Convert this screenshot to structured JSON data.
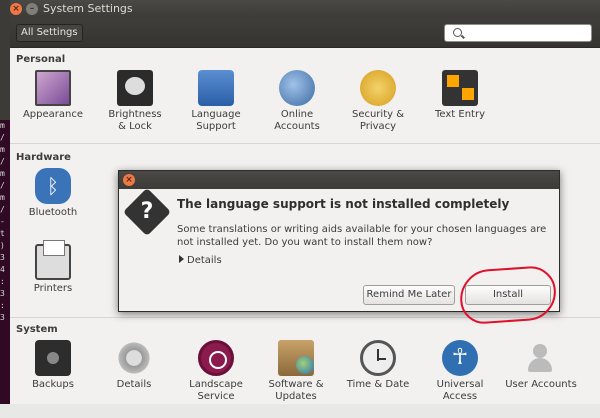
{
  "window": {
    "title": "System Settings"
  },
  "toolbar": {
    "all_settings_label": "All Settings",
    "search_placeholder": ""
  },
  "sections": {
    "personal": {
      "label": "Personal",
      "items": [
        {
          "label": "Appearance",
          "icon": "appearance-icon"
        },
        {
          "label": "Brightness & Lock",
          "icon": "brightness-icon"
        },
        {
          "label": "Language Support",
          "icon": "language-icon"
        },
        {
          "label": "Online Accounts",
          "icon": "online-accounts-icon"
        },
        {
          "label": "Security & Privacy",
          "icon": "security-icon"
        },
        {
          "label": "Text Entry",
          "icon": "text-entry-icon"
        }
      ]
    },
    "hardware": {
      "label": "Hardware",
      "items": [
        {
          "label": "Bluetooth",
          "icon": "bluetooth-icon"
        },
        {
          "label": "Printers",
          "icon": "printer-icon"
        }
      ]
    },
    "system": {
      "label": "System",
      "items": [
        {
          "label": "Backups",
          "icon": "backups-icon"
        },
        {
          "label": "Details",
          "icon": "details-icon"
        },
        {
          "label": "Landscape Service",
          "icon": "landscape-icon"
        },
        {
          "label": "Software & Updates",
          "icon": "software-icon"
        },
        {
          "label": "Time & Date",
          "icon": "clock-icon"
        },
        {
          "label": "Universal Access",
          "icon": "universal-access-icon"
        },
        {
          "label": "User Accounts",
          "icon": "user-accounts-icon"
        }
      ]
    }
  },
  "dialog": {
    "heading": "The language support is not installed completely",
    "message": "Some translations or writing aids available for your chosen languages are not installed yet. Do you want to install them now?",
    "details_label": "Details",
    "remind_label": "Remind Me Later",
    "install_label": "Install",
    "icon": "question-icon"
  },
  "background_terminal": [
    "m",
    "/",
    "m",
    "/",
    "m",
    "/",
    "m",
    "/",
    "-",
    "t",
    ")",
    "3",
    "4",
    ":",
    "3",
    ":",
    "3"
  ],
  "colors": {
    "titlebar": "#3c3b37",
    "window_bg": "#f2f1f0",
    "close_button": "#f07746",
    "annotation": "#e0102a"
  }
}
